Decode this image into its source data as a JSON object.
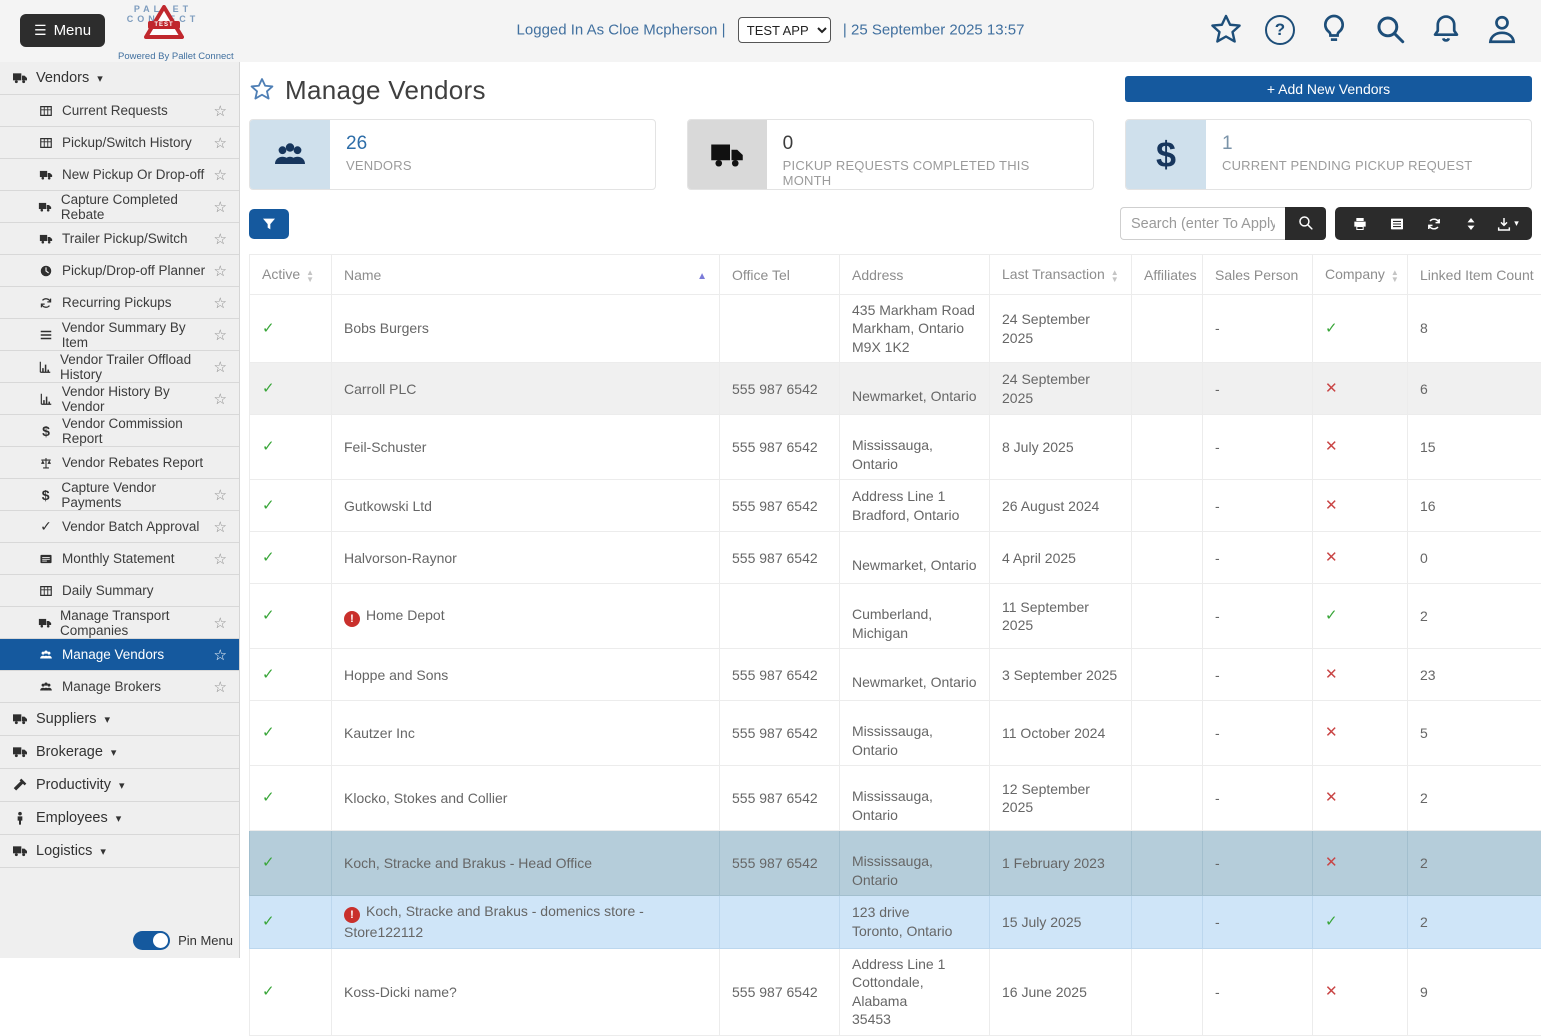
{
  "colors": {
    "accent": "#15599e",
    "link_blue": "#41709f",
    "icon_blue": "#1d4e79",
    "green_check": "#3aa63a",
    "red_x": "#c94545",
    "alert_red": "#c9302c",
    "row_selected": "#b5cdda",
    "row_highlight": "#cfe5f8",
    "row_striped": "#f0f0f0"
  },
  "header": {
    "menu_label": "Menu",
    "logo": {
      "line1": "PALLET",
      "line2": "CONNECT",
      "badge": "TEST",
      "powered_by": "Powered By Pallet Connect"
    },
    "logged_in": "Logged In As Cloe Mcpherson  |",
    "app_option": "TEST APP",
    "datetime": "|  25 September 2025 13:57",
    "icons": [
      "star",
      "question",
      "bulb",
      "search",
      "bell",
      "user"
    ]
  },
  "sidebar": {
    "pin_label": "Pin Menu",
    "groups": [
      {
        "label": "Vendors",
        "icon": "truck",
        "expanded": true,
        "items": [
          {
            "label": "Current Requests",
            "icon": "grid",
            "starred": true
          },
          {
            "label": "Pickup/Switch History",
            "icon": "grid",
            "starred": true
          },
          {
            "label": "New Pickup Or Drop-off",
            "icon": "truck",
            "starred": true
          },
          {
            "label": "Capture Completed Rebate",
            "icon": "truck",
            "starred": true
          },
          {
            "label": "Trailer Pickup/Switch",
            "icon": "truck",
            "starred": true
          },
          {
            "label": "Pickup/Drop-off Planner",
            "icon": "clock",
            "starred": true
          },
          {
            "label": "Recurring Pickups",
            "icon": "refresh",
            "starred": true
          },
          {
            "label": "Vendor Summary By Item",
            "icon": "rows",
            "starred": true
          },
          {
            "label": "Vendor Trailer Offload History",
            "icon": "chart",
            "starred": true
          },
          {
            "label": "Vendor History By Vendor",
            "icon": "chart",
            "starred": true
          },
          {
            "label": "Vendor Commission Report",
            "icon": "dollar",
            "starred": false
          },
          {
            "label": "Vendor Rebates Report",
            "icon": "scale",
            "starred": false
          },
          {
            "label": "Capture Vendor Payments",
            "icon": "dollar",
            "starred": true
          },
          {
            "label": "Vendor Batch Approval",
            "icon": "check",
            "starred": true
          },
          {
            "label": "Monthly Statement",
            "icon": "card",
            "starred": true
          },
          {
            "label": "Daily Summary",
            "icon": "grid",
            "starred": false
          },
          {
            "label": "Manage Transport Companies",
            "icon": "truck",
            "starred": true
          },
          {
            "label": "Manage Vendors",
            "icon": "users",
            "starred": true,
            "selected": true
          },
          {
            "label": "Manage Brokers",
            "icon": "users",
            "starred": true
          }
        ]
      },
      {
        "label": "Suppliers",
        "icon": "truck"
      },
      {
        "label": "Brokerage",
        "icon": "truck"
      },
      {
        "label": "Productivity",
        "icon": "hammer"
      },
      {
        "label": "Employees",
        "icon": "person"
      },
      {
        "label": "Logistics",
        "icon": "truck"
      }
    ]
  },
  "page": {
    "title": "Manage Vendors",
    "add_button": "+ Add New Vendors"
  },
  "stats": [
    {
      "value": "26",
      "value_color": "#2d6da8",
      "label": "VENDORS",
      "icon": "users",
      "icon_style": "blue"
    },
    {
      "value": "0",
      "value_color": "#3c3c3c",
      "label": "PICKUP REQUESTS COMPLETED THIS MONTH",
      "icon": "truck",
      "icon_style": "gray"
    },
    {
      "value": "1",
      "value_color": "#7a93a8",
      "label": "CURRENT PENDING PICKUP REQUEST",
      "icon": "dollar",
      "icon_style": "blue"
    }
  ],
  "toolbar": {
    "search_placeholder": "Search (enter To Apply)",
    "dark_buttons": [
      "printer",
      "list",
      "refresh",
      "sortud",
      "download"
    ]
  },
  "table": {
    "columns": [
      {
        "label": "Active",
        "sort": "both"
      },
      {
        "label": "Name",
        "sort": "asc"
      },
      {
        "label": "Office Tel",
        "sort": "none"
      },
      {
        "label": "Address",
        "sort": "none"
      },
      {
        "label": "Last Transaction",
        "sort": "both"
      },
      {
        "label": "Affiliates",
        "sort": "none"
      },
      {
        "label": "Sales Person",
        "sort": "none"
      },
      {
        "label": "Company",
        "sort": "both"
      },
      {
        "label": "Linked Item Count",
        "sort": "none"
      }
    ],
    "rows": [
      {
        "active": true,
        "alert": false,
        "name": "Bobs Burgers",
        "tel": "",
        "address": [
          "435 Markham Road",
          "Markham, Ontario",
          "M9X 1K2"
        ],
        "last_transaction": "24 September 2025",
        "affiliates": "",
        "sales_person": "-",
        "company": true,
        "linked_count": "8",
        "highlight": ""
      },
      {
        "active": true,
        "alert": false,
        "name": "Carroll PLC",
        "tel": "555 987 6542",
        "address": [
          "Newmarket, Ontario"
        ],
        "last_transaction": "24 September 2025",
        "affiliates": "",
        "sales_person": "-",
        "company": false,
        "linked_count": "6",
        "highlight": "gray"
      },
      {
        "active": true,
        "alert": false,
        "name": "Feil-Schuster",
        "tel": "555 987 6542",
        "address": [
          "Mississauga, Ontario"
        ],
        "last_transaction": "8 July 2025",
        "affiliates": "",
        "sales_person": "-",
        "company": false,
        "linked_count": "15",
        "highlight": ""
      },
      {
        "active": true,
        "alert": false,
        "name": "Gutkowski Ltd",
        "tel": "555 987 6542",
        "address": [
          "Address Line 1",
          "Bradford, Ontario"
        ],
        "last_transaction": "26 August 2024",
        "affiliates": "",
        "sales_person": "-",
        "company": false,
        "linked_count": "16",
        "highlight": ""
      },
      {
        "active": true,
        "alert": false,
        "name": "Halvorson-Raynor",
        "tel": "555 987 6542",
        "address": [
          "Newmarket, Ontario"
        ],
        "last_transaction": "4 April 2025",
        "affiliates": "",
        "sales_person": "-",
        "company": false,
        "linked_count": "0",
        "highlight": ""
      },
      {
        "active": true,
        "alert": true,
        "name": "Home Depot",
        "tel": "",
        "address": [
          "Cumberland, Michigan"
        ],
        "last_transaction": "11 September 2025",
        "affiliates": "",
        "sales_person": "-",
        "company": true,
        "linked_count": "2",
        "highlight": ""
      },
      {
        "active": true,
        "alert": false,
        "name": "Hoppe and Sons",
        "tel": "555 987 6542",
        "address": [
          "Newmarket, Ontario"
        ],
        "last_transaction": "3 September 2025",
        "affiliates": "",
        "sales_person": "-",
        "company": false,
        "linked_count": "23",
        "highlight": ""
      },
      {
        "active": true,
        "alert": false,
        "name": "Kautzer Inc",
        "tel": "555 987 6542",
        "address": [
          "Mississauga, Ontario"
        ],
        "last_transaction": "11 October 2024",
        "affiliates": "",
        "sales_person": "-",
        "company": false,
        "linked_count": "5",
        "highlight": ""
      },
      {
        "active": true,
        "alert": false,
        "name": "Klocko, Stokes and Collier",
        "tel": "555 987 6542",
        "address": [
          "Mississauga, Ontario"
        ],
        "last_transaction": "12 September 2025",
        "affiliates": "",
        "sales_person": "-",
        "company": false,
        "linked_count": "2",
        "highlight": ""
      },
      {
        "active": true,
        "alert": false,
        "name": "Koch, Stracke and Brakus - Head Office",
        "tel": "555 987 6542",
        "address": [
          "Mississauga, Ontario"
        ],
        "last_transaction": "1 February 2023",
        "affiliates": "",
        "sales_person": "-",
        "company": false,
        "linked_count": "2",
        "highlight": "selected"
      },
      {
        "active": true,
        "alert": true,
        "name": "Koch, Stracke and Brakus - domenics store - Store122112",
        "tel": "",
        "address": [
          "123 drive",
          "Toronto, Ontario"
        ],
        "last_transaction": "15 July 2025",
        "affiliates": "",
        "sales_person": "-",
        "company": true,
        "linked_count": "2",
        "highlight": "blue"
      },
      {
        "active": true,
        "alert": false,
        "name": "Koss-Dicki name?",
        "tel": "555 987 6542",
        "address": [
          "Address Line 1",
          "Cottondale, Alabama",
          "35453"
        ],
        "last_transaction": "16 June 2025",
        "affiliates": "",
        "sales_person": "-",
        "company": false,
        "linked_count": "9",
        "highlight": ""
      }
    ]
  }
}
